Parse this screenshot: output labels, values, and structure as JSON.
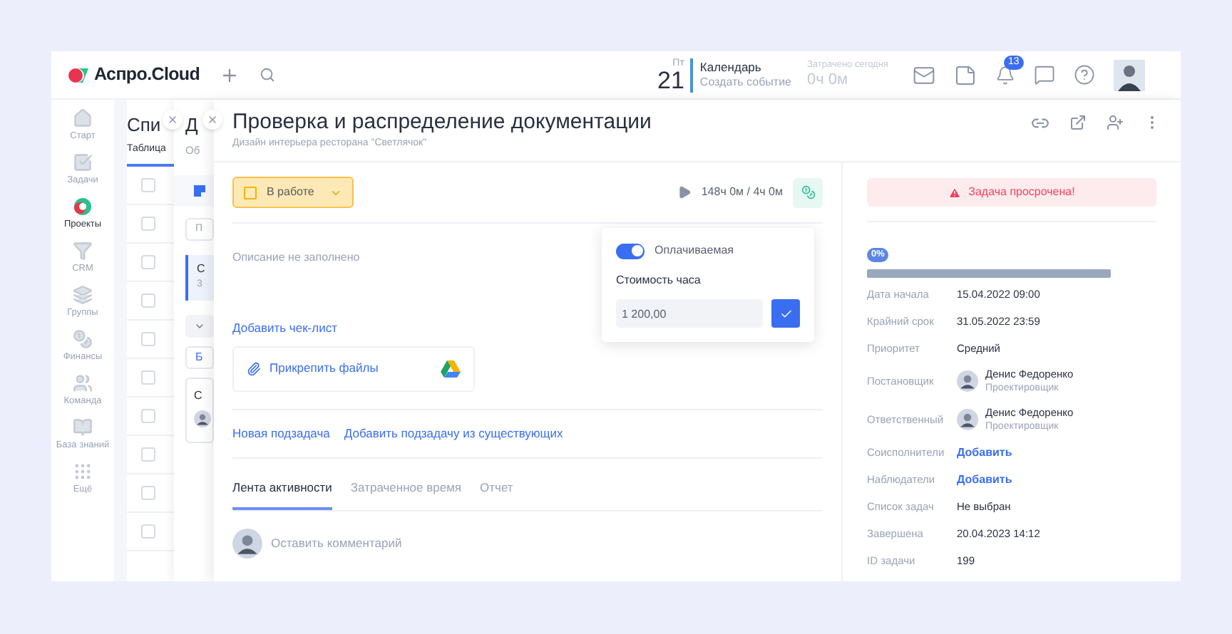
{
  "header": {
    "logo": "Аспро.Cloud",
    "day_of_week": "Пт",
    "day": "21",
    "calendar_title": "Календарь",
    "calendar_action": "Создать событие",
    "spent_label": "Затрачено сегодня",
    "spent_value": "0ч 0м",
    "notifications_count": "13"
  },
  "sidebar": {
    "items": [
      {
        "label": "Старт",
        "selected": false
      },
      {
        "label": "Задачи",
        "selected": false
      },
      {
        "label": "Проекты",
        "selected": true
      },
      {
        "label": "CRM",
        "selected": false
      },
      {
        "label": "Группы",
        "selected": false
      },
      {
        "label": "Финансы",
        "selected": false
      },
      {
        "label": "Команда",
        "selected": false
      },
      {
        "label": "База знаний",
        "selected": false
      },
      {
        "label": "Ещё",
        "selected": false
      }
    ]
  },
  "back_panels": [
    {
      "title": "Спи",
      "subtitle": "Таблица",
      "rows": [
        {
          "checked": false
        },
        {
          "checked": false
        },
        {
          "checked": false
        },
        {
          "checked": false
        },
        {
          "checked": false
        },
        {
          "checked": false
        },
        {
          "checked": false
        },
        {
          "checked": false
        },
        {
          "checked": false
        },
        {
          "checked": false
        }
      ]
    },
    {
      "title": "Д",
      "subtitle": "Об",
      "field": "П",
      "card_title": "С",
      "card_sub": "3",
      "button": "Б",
      "card2": "С"
    }
  ],
  "task": {
    "title": "Проверка и распределение документации",
    "project": "Дизайн интерьера ресторана \"Светлячок\"",
    "status": "В работе",
    "timer": "148ч 0м / 4ч 0м",
    "description_placeholder": "Описание не заполнено",
    "add_checklist": "Добавить чек-лист",
    "attach": "Прикрепить файлы",
    "subtask_links": [
      "Новая подзадача",
      "Добавить подзадачу из существующих"
    ],
    "tabs": [
      {
        "label": "Лента активности",
        "selected": true
      },
      {
        "label": "Затраченное время",
        "selected": false
      },
      {
        "label": "Отчет",
        "selected": false
      }
    ],
    "comment_placeholder": "Оставить комментарий"
  },
  "popover": {
    "billable_label": "Оплачиваемая",
    "billable_on": true,
    "rate_label": "Стоимость часа",
    "rate_value": "1 200,00"
  },
  "details": {
    "alert": "Задача просрочена!",
    "progress_label": "0%",
    "level": 0,
    "fields": [
      {
        "kind": "text",
        "label": "Дата начала",
        "value": "15.04.2022 09:00"
      },
      {
        "kind": "text",
        "label": "Крайний срок",
        "value": "31.05.2022 23:59"
      },
      {
        "kind": "text",
        "label": "Приоритет",
        "value": "Средний"
      },
      {
        "kind": "person",
        "label": "Постановщик",
        "name": "Денис Федоренко",
        "role": "Проектировщик"
      },
      {
        "kind": "person",
        "label": "Ответственный",
        "name": "Денис Федоренко",
        "role": "Проектировщик"
      },
      {
        "kind": "link",
        "label": "Соисполнители",
        "value": "Добавить"
      },
      {
        "kind": "link",
        "label": "Наблюдатели",
        "value": "Добавить"
      },
      {
        "kind": "text",
        "label": "Список задач",
        "value": "Не выбран"
      },
      {
        "kind": "text",
        "label": "Завершена",
        "value": "20.04.2023 14:12"
      },
      {
        "kind": "text",
        "label": "ID задачи",
        "value": "199"
      }
    ]
  }
}
